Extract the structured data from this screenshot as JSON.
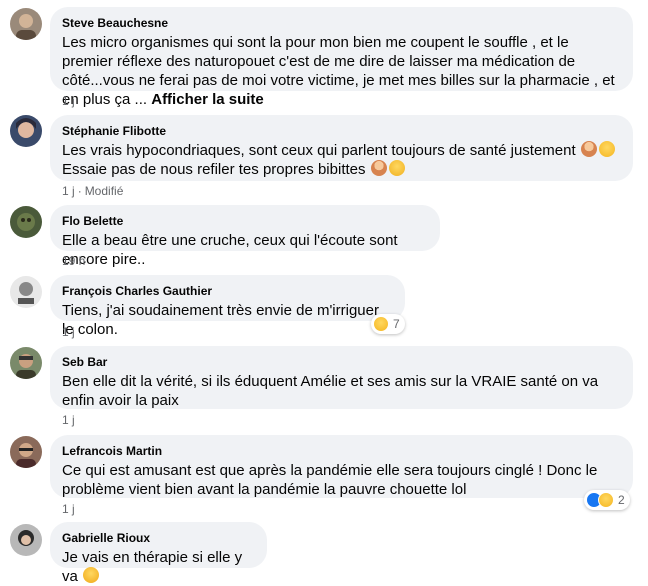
{
  "comments": [
    {
      "author": "Steve Beauchesne",
      "text": "Les micro organismes qui sont la pour mon bien me coupent le souffle , et le premier réflexe des naturopouet c'est de me dire de laisser ma médication de côté...vous ne ferai pas de moi votre victime, je met mes billes sur la pharmacie , et en plus ça ...",
      "see_more": "Afficher la suite",
      "time": "1 j"
    },
    {
      "author": "Stéphanie Flibotte",
      "text_a": "Les vrais hypocondriaques, sont ceux qui parlent toujours de santé justement",
      "text_b": "Essaie pas de nous refiler tes propres bibittes",
      "time": "1 j",
      "edited": "Modifié"
    },
    {
      "author": "Flo Belette",
      "text": "Elle a beau être une cruche, ceux qui l'écoute sont encore pire..",
      "time": "19 h"
    },
    {
      "author": "François Charles Gauthier",
      "text": "Tiens, j'ai soudainement très envie de m'irriguer le colon.",
      "time": "1 j",
      "reaction_count": "7"
    },
    {
      "author": "Seb Bar",
      "text": "Ben elle dit la vérité, si ils éduquent Amélie et ses amis sur la VRAIE santé on va enfin avoir la paix",
      "time": "1 j"
    },
    {
      "author": "Lefrancois Martin",
      "text": "Ce qui est amusant est que après la pandémie elle sera toujours cinglé ! Donc le problème vient bien avant la pandémie la pauvre chouette lol",
      "time": "1 j",
      "reaction_count": "2"
    },
    {
      "author": "Gabrielle Rioux",
      "text": "Je vais en thérapie si elle y va"
    }
  ]
}
